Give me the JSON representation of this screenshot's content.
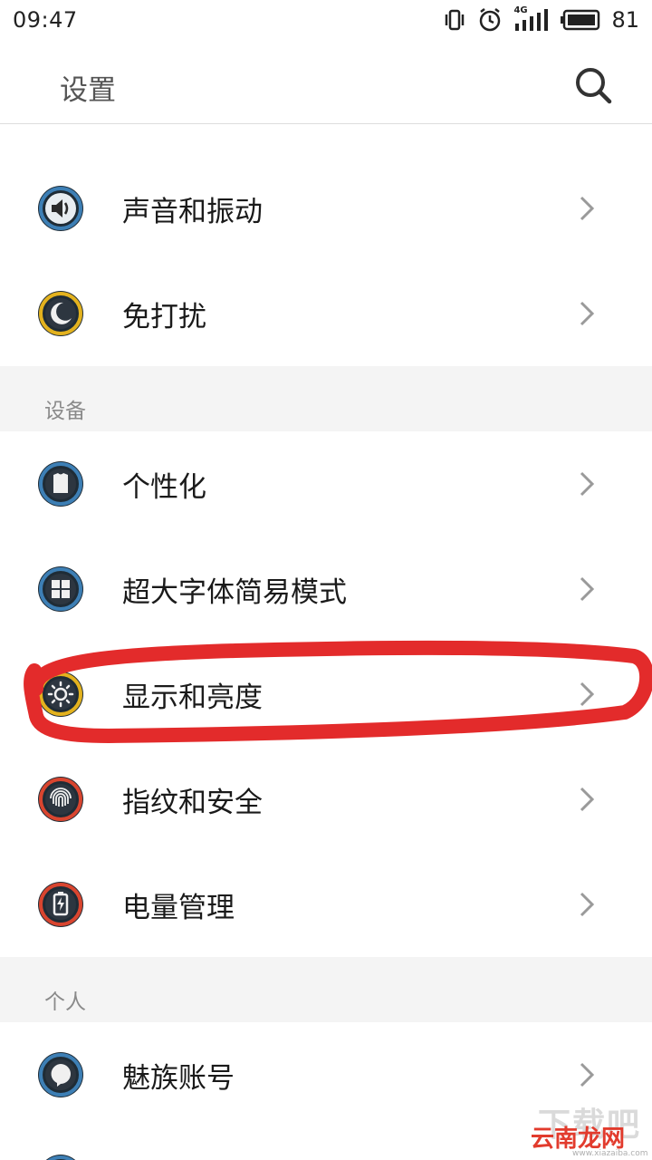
{
  "status_bar": {
    "time": "09:47",
    "network": "4G",
    "battery": "81",
    "icons": [
      "vibrate-icon",
      "alarm-icon",
      "signal-icon",
      "battery-icon"
    ]
  },
  "header": {
    "title": "设置",
    "search_icon": "search-icon"
  },
  "sections": [
    {
      "label": "",
      "items": [
        {
          "label": "声音和振动",
          "icon": "sound-icon"
        },
        {
          "label": "免打扰",
          "icon": "moon-icon"
        }
      ]
    },
    {
      "label": "设备",
      "items": [
        {
          "label": "个性化",
          "icon": "shirt-icon"
        },
        {
          "label": "超大字体简易模式",
          "icon": "grid-icon"
        },
        {
          "label": "显示和亮度",
          "icon": "brightness-icon"
        },
        {
          "label": "指纹和安全",
          "icon": "fingerprint-icon"
        },
        {
          "label": "电量管理",
          "icon": "battery-charge-icon"
        }
      ]
    },
    {
      "label": "个人",
      "items": [
        {
          "label": "魅族账号",
          "icon": "account-icon"
        }
      ]
    }
  ],
  "watermark": {
    "line1": "下载吧",
    "line2": "云南龙网",
    "line3": "www.xiazaiba.com"
  },
  "colors": {
    "icon_ring_blue": "#3d7fb5",
    "icon_ring_yellow": "#e3b21e",
    "icon_ring_red": "#d9452f",
    "annotation_red": "#e32b2b",
    "section_bg": "#f4f4f4"
  }
}
